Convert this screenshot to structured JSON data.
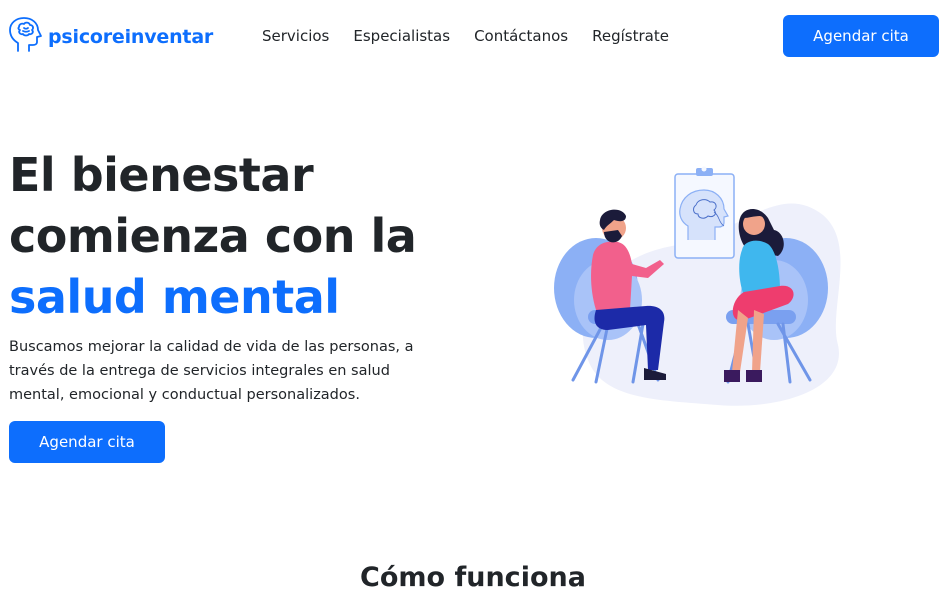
{
  "navbar": {
    "brand": "psicoreinventar",
    "brand_icon": "brain-head-icon",
    "links": [
      "Servicios",
      "Especialistas",
      "Contáctanos",
      "Regístrate"
    ],
    "cta": "Agendar cita"
  },
  "hero": {
    "title_line1": "El bienestar",
    "title_line2": "comienza con la",
    "title_highlight": "salud mental",
    "description": "Buscamos mejorar la calidad de vida de las personas, a través de la entrega de servicios integrales en salud mental, emocional y conductual personalizados.",
    "cta": "Agendar cita",
    "illustration_icon": "therapy-session-illustration"
  },
  "section": {
    "title": "Cómo funciona"
  },
  "colors": {
    "primary": "#0d6efd",
    "text": "#212529",
    "background": "#ffffff"
  }
}
